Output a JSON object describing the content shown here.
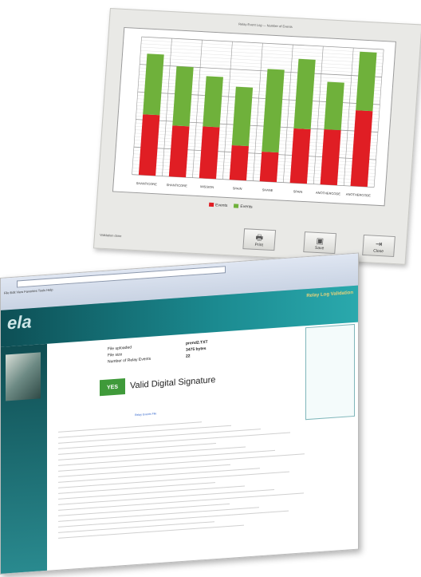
{
  "window1": {
    "title": "Relay Event Log — Number of Events",
    "status": "Validation done",
    "buttons": [
      "Print",
      "Save",
      "Close"
    ],
    "legend": [
      "Events",
      "Events"
    ]
  },
  "chart_data": {
    "type": "bar",
    "stacked": true,
    "categories": [
      "SHANTICORE",
      "SHANTICORE",
      "MISSION",
      "SPAIN",
      "SHANE",
      "SPAIN",
      "ANOTHERCODE",
      "ANOTHERCODE"
    ],
    "series": [
      {
        "values": [
          88,
          74,
          75,
          50,
          43,
          79,
          80,
          110
        ]
      },
      {
        "values": [
          88,
          86,
          73,
          85,
          120,
          101,
          69,
          85
        ]
      }
    ],
    "ylim": [
      0,
      200
    ],
    "colors": [
      "#e01e24",
      "#6fb13b"
    ],
    "grid": true
  },
  "window2": {
    "info_labels": [
      "File uploaded",
      "File size",
      "Number of Relay Events"
    ],
    "info_values": [
      "prend2.TXT",
      "3475 bytes",
      "22"
    ],
    "yes_label": "YES",
    "valid_text": "Valid Digital Signature",
    "detail_link": "Relay Events File",
    "tagline": "Relay Log Validation",
    "logo": "ela"
  }
}
